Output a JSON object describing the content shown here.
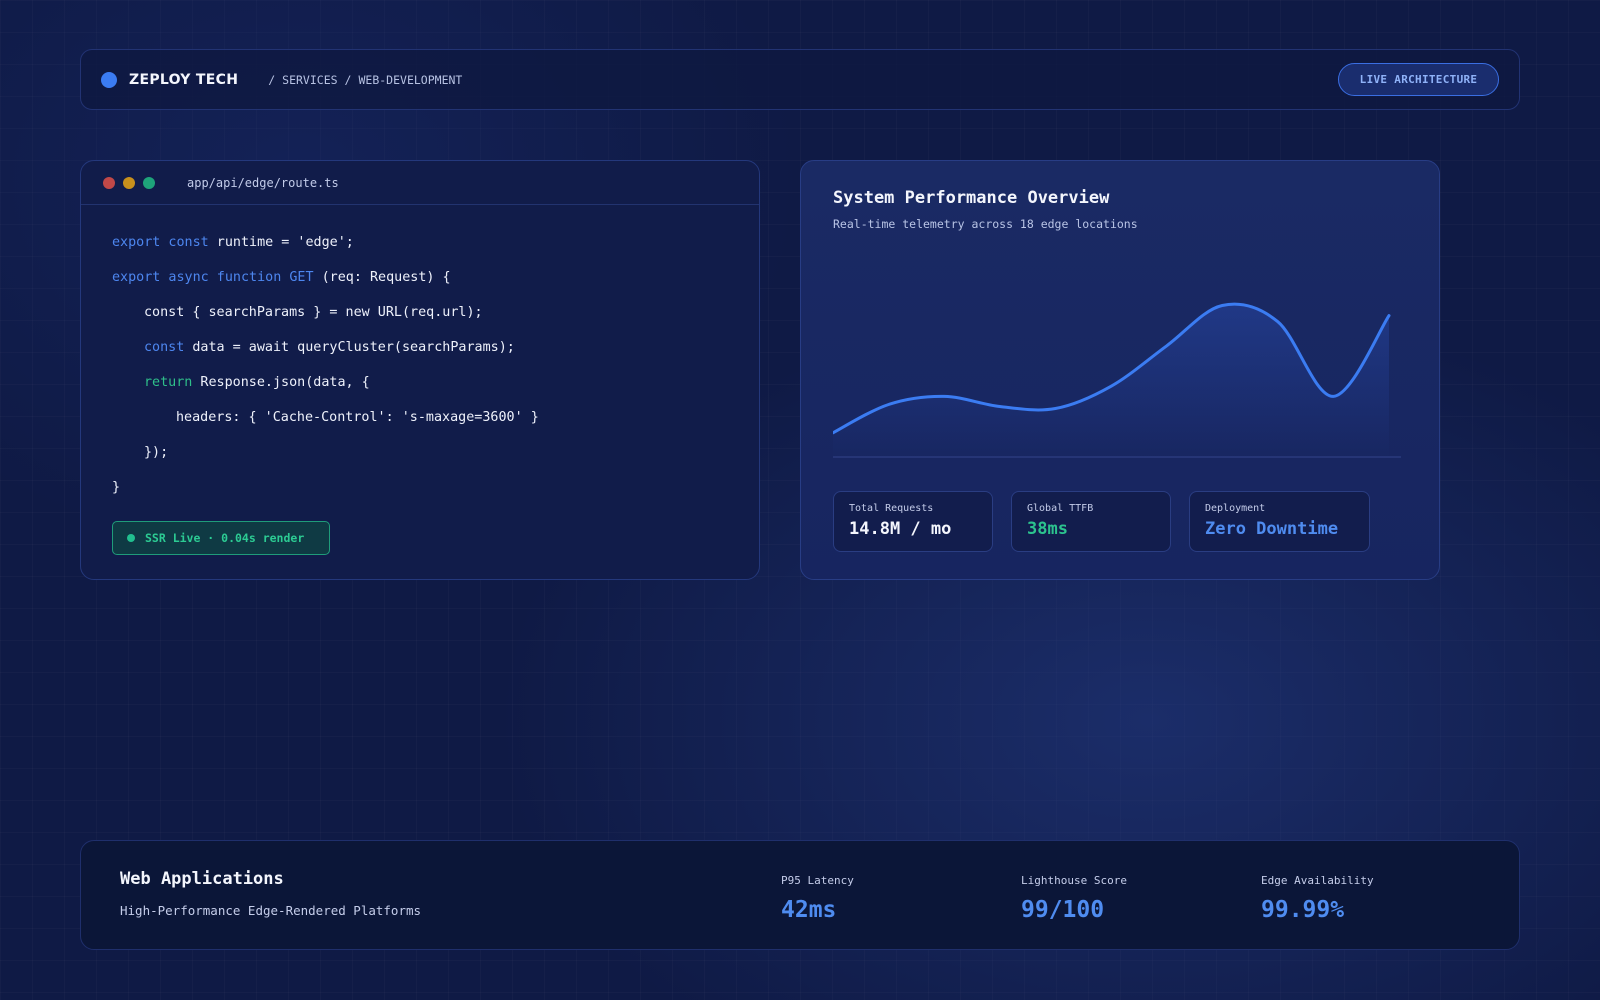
{
  "header": {
    "brand": "ZEPLOY TECH",
    "breadcrumb": [
      "SERVICES",
      "WEB-DEVELOPMENT"
    ],
    "separator": "/",
    "action_label": "LIVE ARCHITECTURE"
  },
  "code_panel": {
    "file_path": "app/api/edge/route.ts",
    "lines": [
      {
        "kw1": "export const",
        "text": " runtime = 'edge';"
      },
      {
        "kw1": "export async function GET",
        "text": " (req: Request) {"
      },
      {
        "text": "const { searchParams } = new URL(req.url);"
      },
      {
        "kw1": "const",
        "text": " data = await queryCluster(searchParams);"
      },
      {
        "kw1": "return",
        "text": " Response.json(data, {"
      },
      {
        "text": "headers: { 'Cache-Control': 's-maxage=3600' }"
      },
      {
        "text": "});"
      },
      {
        "text": "}"
      }
    ],
    "status": "SSR Live · 0.04s render"
  },
  "performance": {
    "title": "System Performance Overview",
    "subtitle": "Real-time telemetry across 18 edge locations",
    "metrics": [
      {
        "label": "Total Requests",
        "value": "14.8M / mo"
      },
      {
        "label": "Global TTFB",
        "value": "38ms"
      },
      {
        "label": "Deployment",
        "value": "Zero Downtime"
      }
    ],
    "colors": {
      "line": "#3b7cf2",
      "accent_green": "#2cc38e"
    }
  },
  "chart_data": {
    "type": "area",
    "title": "",
    "xlabel": "",
    "ylabel": "",
    "x": [
      0,
      1,
      2,
      3,
      4,
      5,
      6,
      7,
      8,
      9,
      10
    ],
    "series": [
      {
        "values": [
          12,
          26,
          30,
          25,
          24,
          35,
          55,
          75,
          67,
          30,
          70
        ]
      }
    ],
    "ylim": [
      0,
      100
    ],
    "grid": false
  },
  "bottom": {
    "title": "Web Applications",
    "subtitle": "High-Performance Edge-Rendered Platforms",
    "stats": [
      {
        "label": "P95 Latency",
        "value": "42ms"
      },
      {
        "label": "Lighthouse Score",
        "value": "99/100"
      },
      {
        "label": "Edge Availability",
        "value": "99.99%"
      }
    ]
  }
}
